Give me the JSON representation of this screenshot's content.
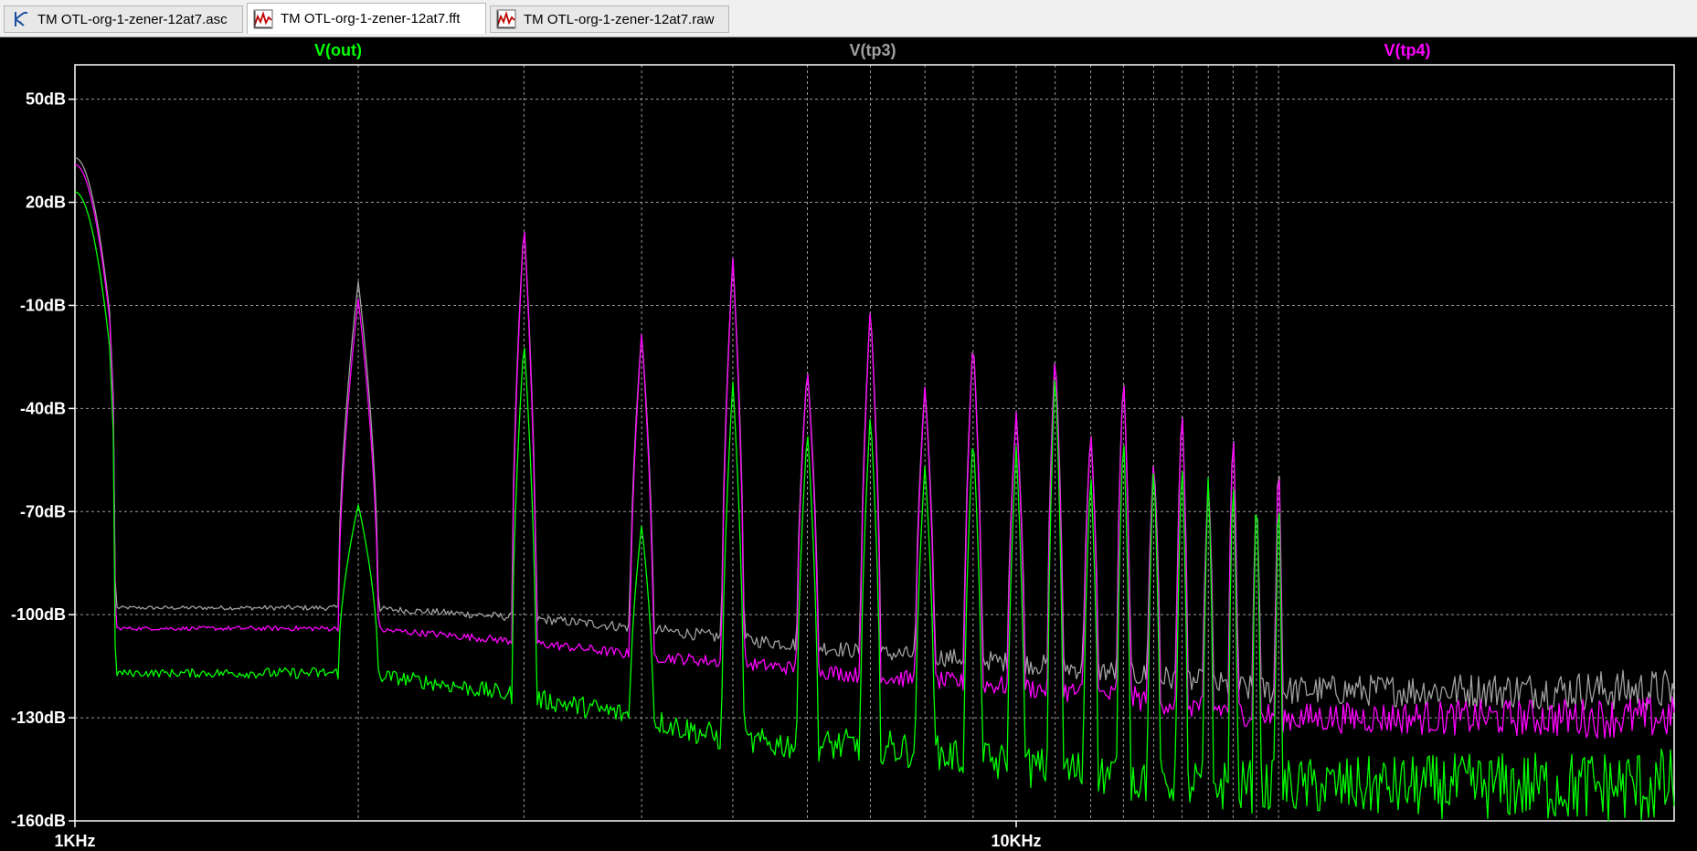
{
  "tabs": [
    {
      "label": "TM OTL-org-1-zener-12at7.asc",
      "icon": "schematic-icon",
      "active": false
    },
    {
      "label": "TM OTL-org-1-zener-12at7.fft",
      "icon": "waveform-icon",
      "active": true
    },
    {
      "label": "TM OTL-org-1-zener-12at7.raw",
      "icon": "waveform-icon",
      "active": false
    }
  ],
  "colors": {
    "vout": "#00ff00",
    "vtp3": "#a0a0a0",
    "vtp4": "#ff00ff",
    "grid": "#9a9a9a",
    "background": "#000000"
  },
  "chart_data": {
    "type": "line",
    "title": "",
    "xscale": "log",
    "xlim": [
      1000,
      19300
    ],
    "ylim": [
      -160,
      60
    ],
    "grid": true,
    "legend_placement": "top",
    "ylabels": [
      "50dB",
      "20dB",
      "-10dB",
      "-40dB",
      "-70dB",
      "-100dB",
      "-130dB",
      "-160dB"
    ],
    "yticks": [
      50,
      20,
      -10,
      -40,
      -70,
      -100,
      -130,
      -160
    ],
    "xlabels": [
      "1KHz",
      "10KHz"
    ],
    "xticks": [
      1000,
      10000
    ],
    "fundamental_hz": 1000,
    "harmonic_hz": [
      2000,
      3000,
      4000,
      5000,
      6000,
      7000,
      8000,
      9000,
      10000,
      11000,
      12000,
      13000,
      14000,
      15000,
      16000,
      17000,
      18000,
      19000
    ],
    "series": [
      {
        "name": "V(out)",
        "color": "#00ff00",
        "fundamental_db": 23,
        "harmonic_db": [
          -68,
          -20,
          -74,
          -32,
          -46,
          -41,
          -56,
          -47,
          -51,
          -27,
          -58,
          -46,
          -55,
          -53,
          -58,
          -57,
          -60,
          -58
        ],
        "floor_db": [
          -117,
          -124,
          -130,
          -137,
          -138,
          -138,
          -140,
          -142,
          -144,
          -145,
          -146,
          -147,
          -148,
          -149,
          -149,
          -150,
          -150,
          -150
        ]
      },
      {
        "name": "V(tp3)",
        "color": "#a0a0a0",
        "fundamental_db": 33,
        "harmonic_db": [
          -3,
          14,
          -18,
          4,
          -28,
          -10,
          -33,
          -19,
          -41,
          -23,
          -46,
          -29,
          -54,
          -38,
          -60,
          -44,
          -64,
          -50
        ],
        "floor_db": [
          -98,
          -101,
          -104,
          -107,
          -109,
          -111,
          -112,
          -113,
          -114,
          -115,
          -116,
          -117,
          -118,
          -119,
          -120,
          -121,
          -122,
          -122
        ]
      },
      {
        "name": "V(tp4)",
        "color": "#ff00ff",
        "fundamental_db": 31,
        "harmonic_db": [
          -8,
          14,
          -18,
          4,
          -28,
          -10,
          -33,
          -19,
          -41,
          -23,
          -46,
          -29,
          -54,
          -38,
          -60,
          -44,
          -64,
          -50
        ],
        "floor_db": [
          -104,
          -108,
          -112,
          -114,
          -116,
          -118,
          -119,
          -120,
          -121,
          -122,
          -123,
          -124,
          -125,
          -126,
          -127,
          -128,
          -129,
          -130
        ]
      }
    ]
  }
}
